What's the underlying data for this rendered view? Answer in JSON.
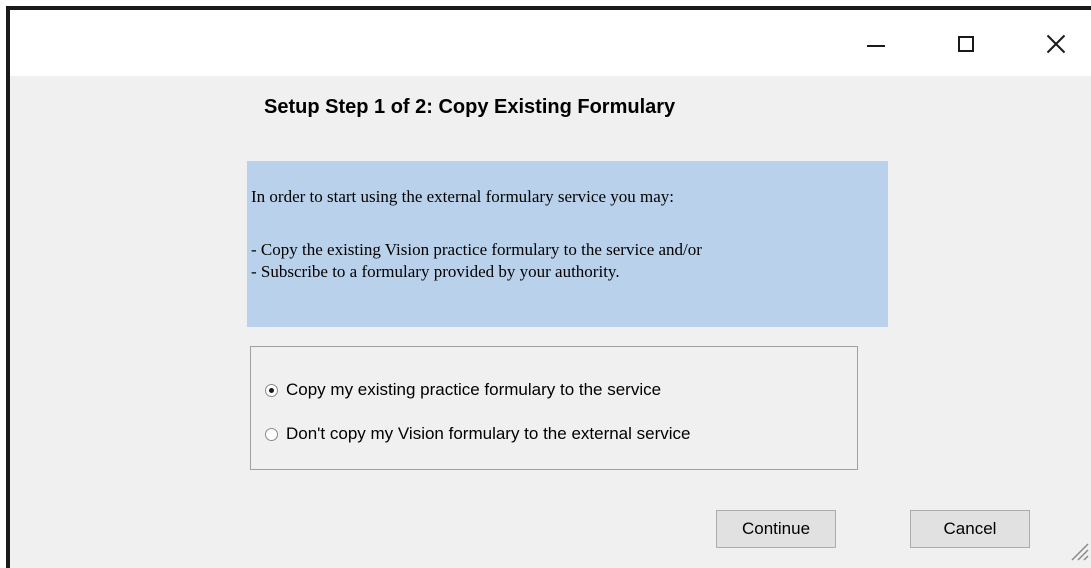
{
  "window": {
    "controls": {
      "minimize_icon": "minimize-icon",
      "maximize_icon": "maximize-icon",
      "close_icon": "close-icon"
    }
  },
  "step_title": "Setup Step 1 of 2: Copy Existing Formulary",
  "info_panel": {
    "background": "#b9d1ea",
    "line_1": "In order to start using the external formulary service you may:",
    "line_2": "- Copy the existing Vision practice formulary to the service and/or",
    "line_3": "- Subscribe to a formulary provided by your authority."
  },
  "options": [
    {
      "label": "Copy my existing practice formulary to the service",
      "checked": true
    },
    {
      "label": "Don't copy my Vision formulary to the external service",
      "checked": false
    }
  ],
  "buttons": {
    "continue_label": "Continue",
    "cancel_label": "Cancel"
  }
}
